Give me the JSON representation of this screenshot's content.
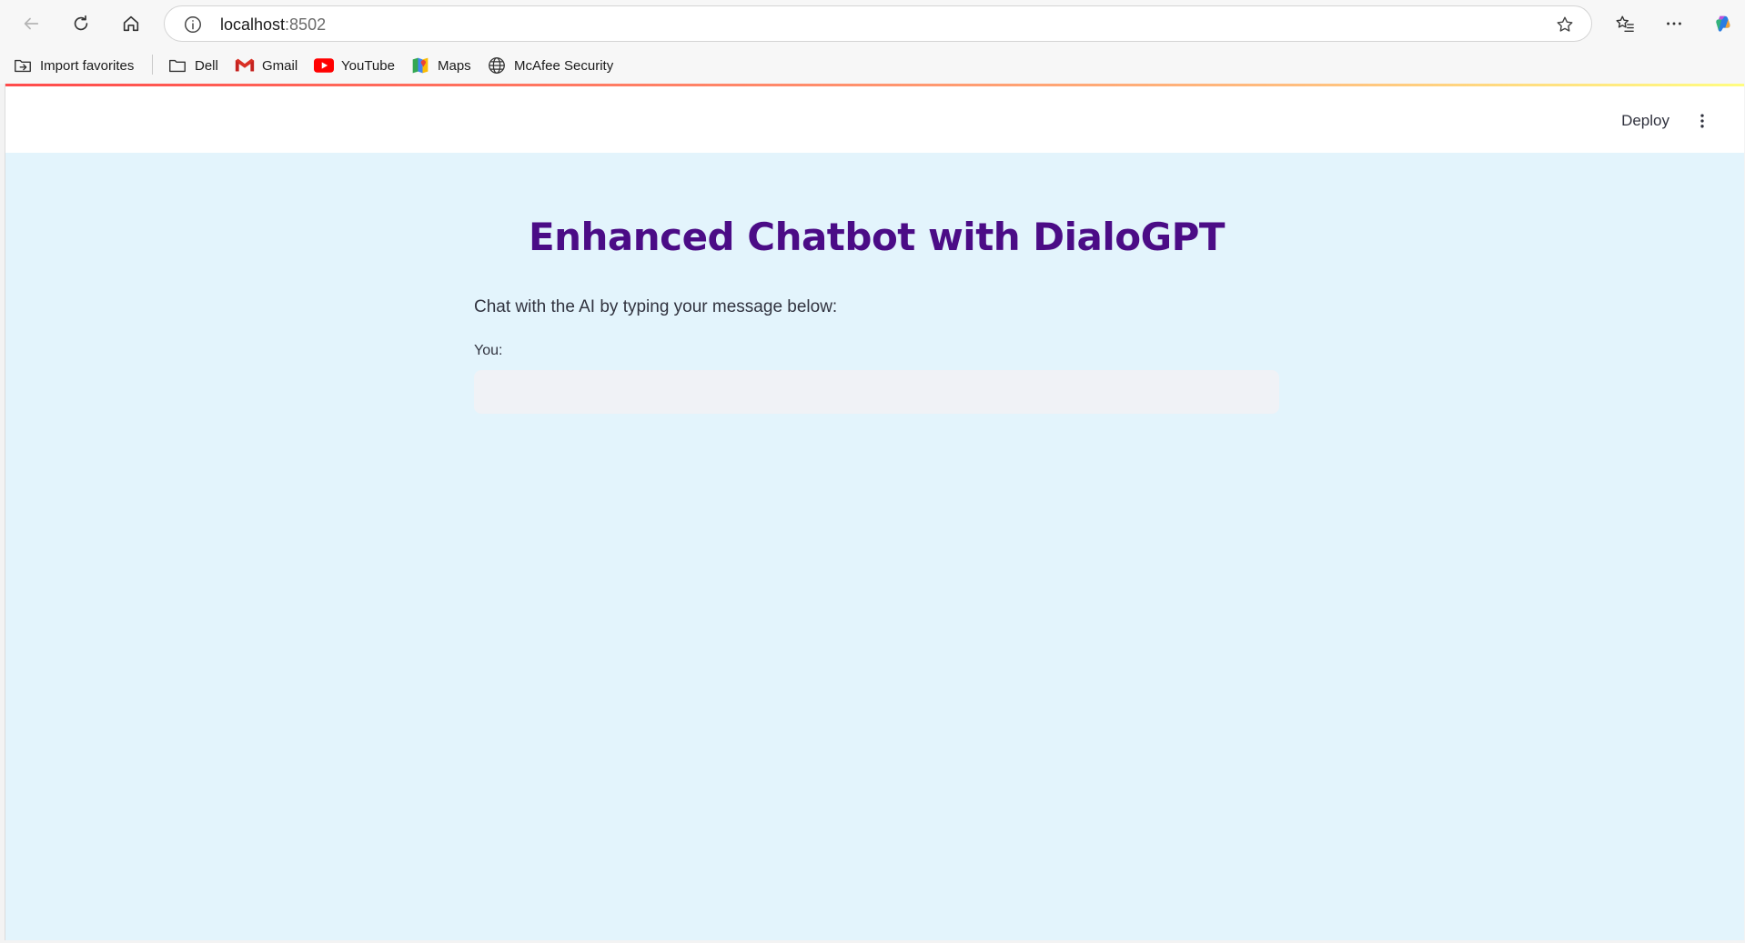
{
  "browser": {
    "url_host": "localhost",
    "url_port": ":8502",
    "favorites": [
      {
        "label": "Import favorites",
        "icon": "import-favorites-icon"
      },
      {
        "label": "Dell",
        "icon": "folder-icon"
      },
      {
        "label": "Gmail",
        "icon": "gmail-icon"
      },
      {
        "label": "YouTube",
        "icon": "youtube-icon"
      },
      {
        "label": "Maps",
        "icon": "maps-icon"
      },
      {
        "label": "McAfee Security",
        "icon": "globe-icon"
      }
    ]
  },
  "app": {
    "deploy_label": "Deploy",
    "title": "Enhanced Chatbot with DialoGPT",
    "subtitle": "Chat with the AI by typing your message below:",
    "input_label": "You:",
    "input_value": ""
  },
  "colors": {
    "title": "#4b0c86",
    "page_background": "#e3f4fc",
    "input_background": "#f0f2f6"
  }
}
